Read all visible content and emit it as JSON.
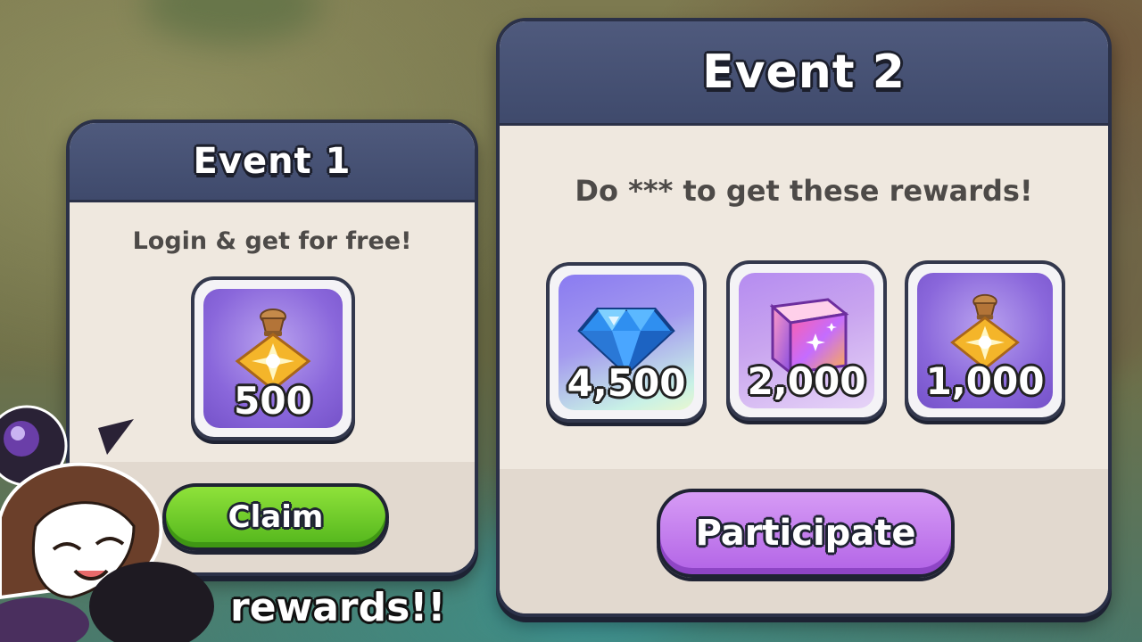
{
  "event1": {
    "title": "Event 1",
    "description": "Login & get for free!",
    "reward": {
      "icon": "gold-pouch-icon",
      "amount": "500"
    },
    "button_label": "Claim"
  },
  "event2": {
    "title": "Event 2",
    "description": "Do *** to get these rewards!",
    "rewards": [
      {
        "icon": "blue-crystal-icon",
        "amount": "4,500"
      },
      {
        "icon": "rainbow-cube-icon",
        "amount": "2,000"
      },
      {
        "icon": "gold-pouch-icon",
        "amount": "1,000"
      }
    ],
    "button_label": "Participate"
  },
  "caption": "rewards!!",
  "colors": {
    "panel_header": "#4a5577",
    "panel_body": "#efe8df",
    "claim_green": "#6ccb2a",
    "participate_purple": "#c47eee"
  }
}
